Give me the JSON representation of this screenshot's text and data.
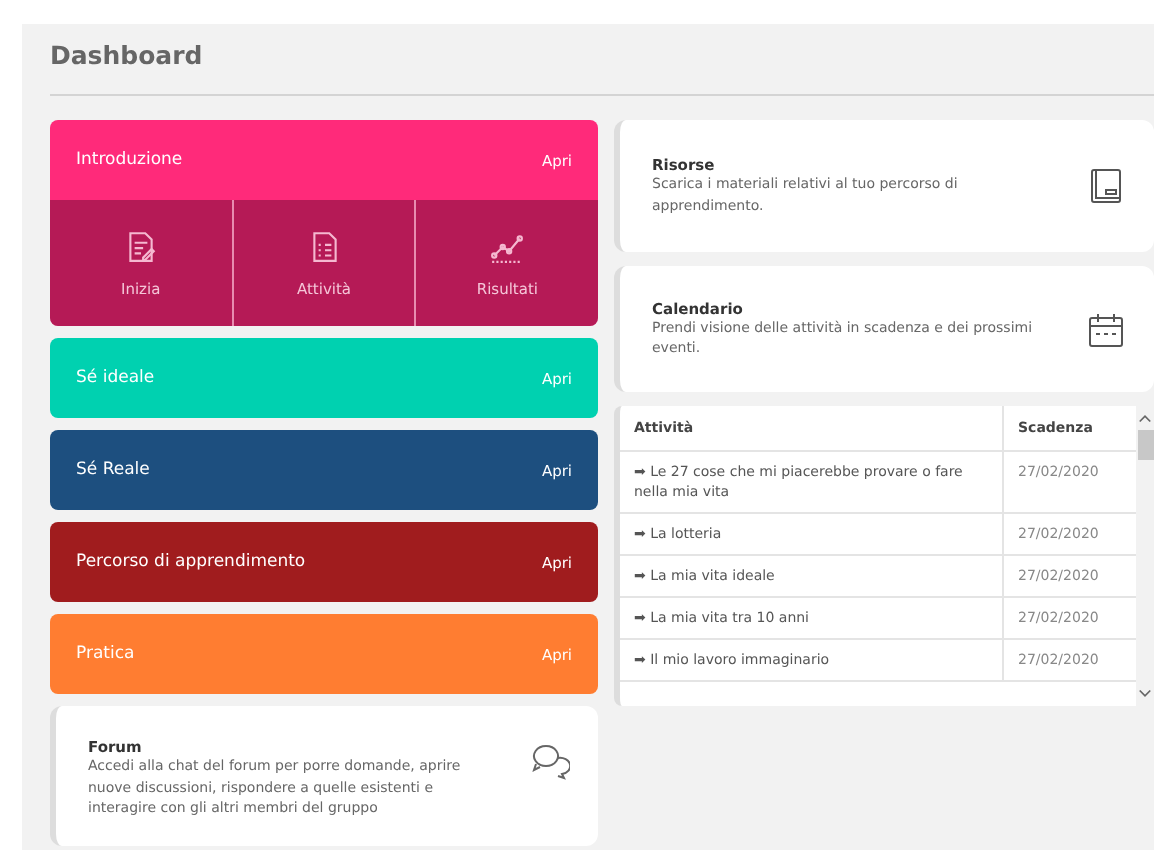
{
  "title": "Dashboard",
  "modules": [
    {
      "label": "Introduzione",
      "action": "Apri",
      "color": "#ff2a7a",
      "subitems": [
        "Inizia",
        "Attività",
        "Risultati"
      ]
    },
    {
      "label": "Sé ideale",
      "action": "Apri",
      "color": "#00d1b0"
    },
    {
      "label": "Sé Reale",
      "action": "Apri",
      "color": "#1d4f7f"
    },
    {
      "label": "Percorso di apprendimento",
      "action": "Apri",
      "color": "#a01c1e"
    },
    {
      "label": "Pratica",
      "action": "Apri",
      "color": "#ff7d31"
    }
  ],
  "forum": {
    "title": "Forum",
    "description": "Accedi alla chat del forum per porre domande, aprire nuove discussioni, rispondere a quelle esistenti e interagire con gli altri membri del gruppo"
  },
  "resources": {
    "title": "Risorse",
    "description": "Scarica i materiali relativi al tuo percorso di apprendimento."
  },
  "calendar": {
    "title": "Calendario",
    "description": "Prendi visione delle attività in scadenza e dei prossimi eventi."
  },
  "table": {
    "columns": [
      "Attività",
      "Scadenza"
    ],
    "rows": [
      [
        "➡ Le 27 cose che mi piacerebbe provare o fare nella mia vita",
        "27/02/2020"
      ],
      [
        "➡ La lotteria",
        "27/02/2020"
      ],
      [
        "➡ La mia vita ideale",
        "27/02/2020"
      ],
      [
        "➡ La mia vita tra 10 anni",
        "27/02/2020"
      ],
      [
        "➡ Il mio lavoro immaginario",
        "27/02/2020"
      ]
    ]
  }
}
